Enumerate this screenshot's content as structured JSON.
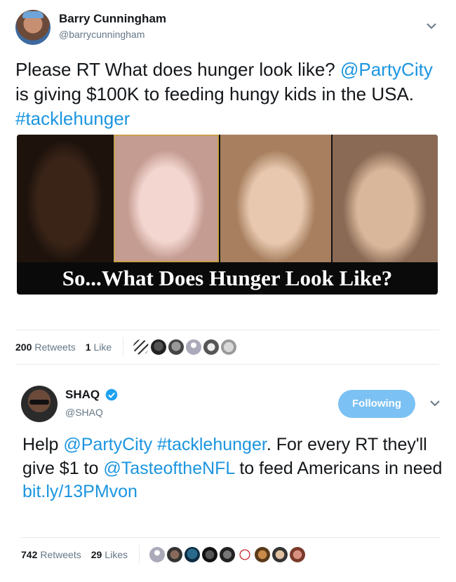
{
  "tweet1": {
    "author_name": "Barry Cunningham",
    "author_handle": "@barrycunningham",
    "text_parts": [
      {
        "text": "Please RT What does hunger look like? ",
        "link": false
      },
      {
        "text": "@PartyCity",
        "link": true
      },
      {
        "text": " is giving $100K to feeding hungy kids in the USA. ",
        "link": false
      },
      {
        "text": "#tacklehunger",
        "link": true
      }
    ],
    "media_caption": "So...What Does Hunger Look Like?",
    "retweets_count": "200",
    "retweets_label": "Retweets",
    "likes_count": "1",
    "likes_label": "Like"
  },
  "tweet2": {
    "author_name": "SHAQ",
    "author_handle": "@SHAQ",
    "follow_label": "Following",
    "text_parts": [
      {
        "text": "Help ",
        "link": false
      },
      {
        "text": "@PartyCity",
        "link": true
      },
      {
        "text": " ",
        "link": false
      },
      {
        "text": "#tacklehunger",
        "link": true
      },
      {
        "text": ". For every RT they'll give $1 to ",
        "link": false
      },
      {
        "text": "@TasteoftheNFL",
        "link": true
      },
      {
        "text": " to feed Americans in need ",
        "link": false
      },
      {
        "text": "bit.ly/13PMvon",
        "link": true
      }
    ],
    "retweets_count": "742",
    "retweets_label": "Retweets",
    "likes_count": "29",
    "likes_label": "Likes"
  },
  "colors": {
    "link": "#1b95e0",
    "follow_button": "#7cc1f3",
    "secondary_text": "#657786",
    "divider": "#e6ecf0",
    "verified": "#1da1f2"
  },
  "icons": {
    "caret": "chevron-down-icon",
    "verified": "verified-badge-icon"
  }
}
